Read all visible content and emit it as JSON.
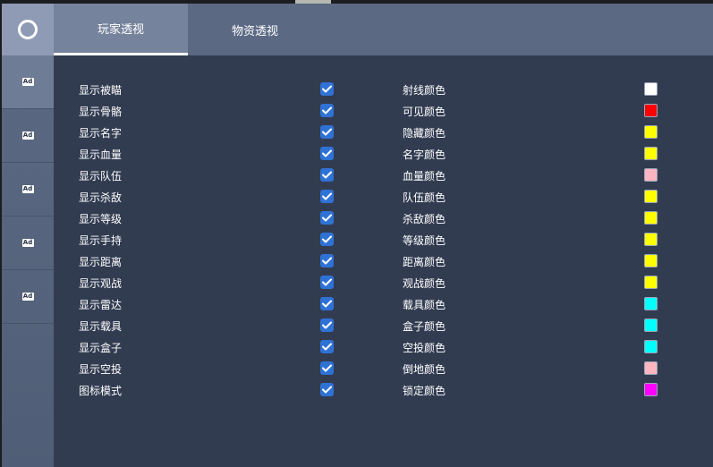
{
  "tabs": [
    {
      "label": "玩家透视",
      "active": true
    },
    {
      "label": "物资透视",
      "active": false
    }
  ],
  "sidebar": {
    "logo_icon": "circle-logo-icon",
    "items": [
      {
        "icon": "Ad",
        "active": true
      },
      {
        "icon": "Ad",
        "active": false
      },
      {
        "icon": "Ad",
        "active": false
      },
      {
        "icon": "Ad",
        "active": false
      },
      {
        "icon": "Ad",
        "active": false
      }
    ]
  },
  "toggles": [
    {
      "label": "显示被瞄",
      "checked": true
    },
    {
      "label": "显示骨骼",
      "checked": true
    },
    {
      "label": "显示名字",
      "checked": true
    },
    {
      "label": "显示血量",
      "checked": true
    },
    {
      "label": "显示队伍",
      "checked": true
    },
    {
      "label": "显示杀敌",
      "checked": true
    },
    {
      "label": "显示等级",
      "checked": true
    },
    {
      "label": "显示手持",
      "checked": true
    },
    {
      "label": "显示距离",
      "checked": true
    },
    {
      "label": "显示观战",
      "checked": true
    },
    {
      "label": "显示雷达",
      "checked": true
    },
    {
      "label": "显示载具",
      "checked": true
    },
    {
      "label": "显示盒子",
      "checked": true
    },
    {
      "label": "显示空投",
      "checked": true
    },
    {
      "label": "图标模式",
      "checked": true
    }
  ],
  "colors": [
    {
      "label": "射线颜色",
      "color": "#ffffff"
    },
    {
      "label": "可见颜色",
      "color": "#ff0000"
    },
    {
      "label": "隐藏颜色",
      "color": "#ffff00"
    },
    {
      "label": "名字颜色",
      "color": "#ffff00"
    },
    {
      "label": "血量颜色",
      "color": "#ffb6c1"
    },
    {
      "label": "队伍颜色",
      "color": "#ffff00"
    },
    {
      "label": "杀敌颜色",
      "color": "#ffff00"
    },
    {
      "label": "等级颜色",
      "color": "#ffff00"
    },
    {
      "label": "距离颜色",
      "color": "#ffff00"
    },
    {
      "label": "观战颜色",
      "color": "#ffff00"
    },
    {
      "label": "载具颜色",
      "color": "#00ffff"
    },
    {
      "label": "盒子颜色",
      "color": "#00ffff"
    },
    {
      "label": "空投颜色",
      "color": "#00ffff"
    },
    {
      "label": "倒地颜色",
      "color": "#ffb6c1"
    },
    {
      "label": "锁定颜色",
      "color": "#ff00ff"
    }
  ],
  "accent_color": "#2f72d6"
}
